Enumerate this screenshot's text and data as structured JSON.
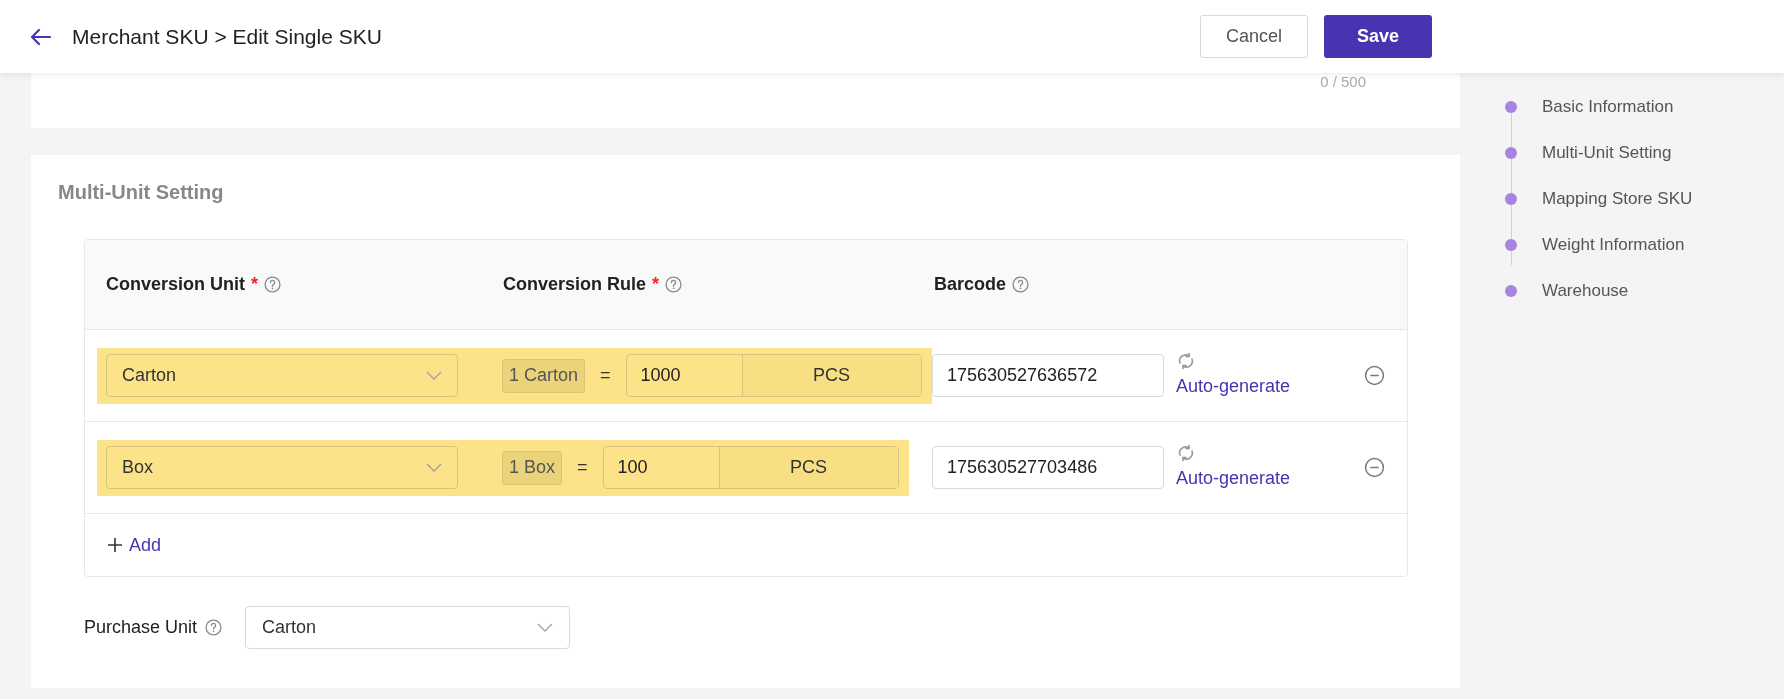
{
  "header": {
    "breadcrumb": "Merchant SKU > Edit Single SKU",
    "buttons": [
      {
        "kind": "secondary",
        "label": "Cancel"
      },
      {
        "kind": "primary",
        "label": "Save"
      }
    ]
  },
  "top_card": {
    "counter": "0 / 500"
  },
  "section": {
    "title": "Multi-Unit Setting",
    "table": {
      "columns": [
        {
          "label": "Conversion Unit",
          "required_mark": "*"
        },
        {
          "label": "Conversion Rule",
          "required_mark": "*"
        },
        {
          "label": "Barcode"
        }
      ],
      "rows": [
        {
          "highlighted": true,
          "unit": "Carton",
          "rule_tag": "1 Carton",
          "equals": "=",
          "quantity": "1000",
          "base_unit": "PCS",
          "barcode": "175630527636572",
          "auto_generate": "Auto-generate"
        },
        {
          "highlighted": true,
          "unit": "Box",
          "rule_tag": "1 Box",
          "equals": "=",
          "quantity": "100",
          "base_unit": "PCS",
          "barcode": "175630527703486",
          "auto_generate": "Auto-generate"
        }
      ],
      "add": "Add"
    },
    "purchase_unit": {
      "label": "Purchase Unit",
      "value": "Carton"
    }
  },
  "anchor_nav": [
    {
      "label": "Basic Information"
    },
    {
      "label": "Multi-Unit Setting"
    },
    {
      "label": "Mapping Store SKU"
    },
    {
      "label": "Weight Information"
    },
    {
      "label": "Warehouse"
    }
  ]
}
